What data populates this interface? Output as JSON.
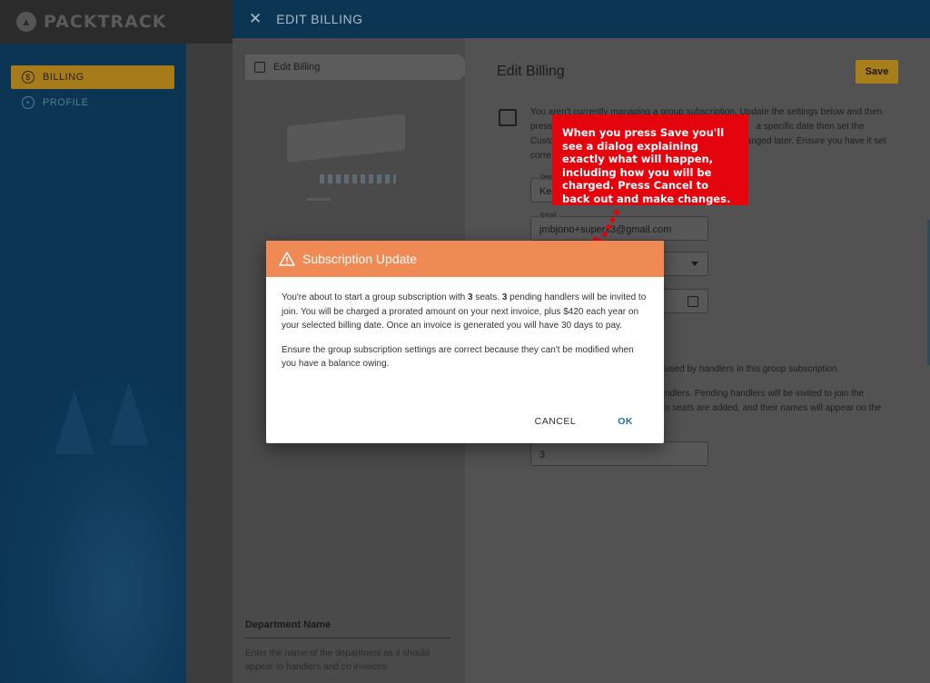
{
  "app": {
    "logo_text": "PACKTRACK",
    "nav": [
      {
        "label": "BILLING",
        "icon": "dollar-icon",
        "active": true
      },
      {
        "label": "PROFILE",
        "icon": "person-icon",
        "active": false
      }
    ]
  },
  "drawer": {
    "title": "EDIT BILLING",
    "steps": [
      {
        "label": "Edit Billing",
        "icon": "calendar-icon"
      }
    ],
    "department": {
      "label": "Department Name",
      "help": "Enter the name of the department as it should appear to handlers and on invoices."
    }
  },
  "main": {
    "title": "Edit Billing",
    "save_label": "Save",
    "intro": {
      "line1": "You aren't currently managing a group subscription. Update the settings below and then",
      "line2a": "press",
      "line2b": "a specific date then set the",
      "line3a": "Custo",
      "line3b": "hanged later. Ensure you have it set",
      "line4": "corre"
    },
    "fields": {
      "department": {
        "label": "Depa",
        "value": "Kel"
      },
      "email": {
        "label": "Email",
        "value": "jmbjono+superx3@gmail.com"
      },
      "seats": {
        "value": "3"
      }
    },
    "texts": {
      "used_by": "used by handlers in this group subscription.",
      "handlers_a": "ndlers. Pending handlers will be invited to join the",
      "handlers_b": "n seats are added, and their names will appear on the"
    }
  },
  "callout": {
    "text": "When you press Save you'll see a dialog explaining exactly what will happen, including how you will be charged. Press Cancel to back out and make changes."
  },
  "modal": {
    "title": "Subscription Update",
    "p1": {
      "a": "You're about to start a group subscription with ",
      "seats": "3",
      "b": " seats. ",
      "pending": "3",
      "c": " pending handlers will be invited to join. You will be charged a prorated amount on your next invoice, plus $420 each year on your selected billing date. Once an invoice is generated you will have 30 days to pay."
    },
    "p2": "Ensure the group subscription settings are correct because they can't be modified when you have a balance owing.",
    "cancel_label": "CANCEL",
    "ok_label": "OK"
  },
  "colors": {
    "sidebar": "#0b3552",
    "accent": "#a67c1a",
    "modal_header": "#ef8a55",
    "callout": "#e3040e",
    "ok": "#1e6fae"
  }
}
